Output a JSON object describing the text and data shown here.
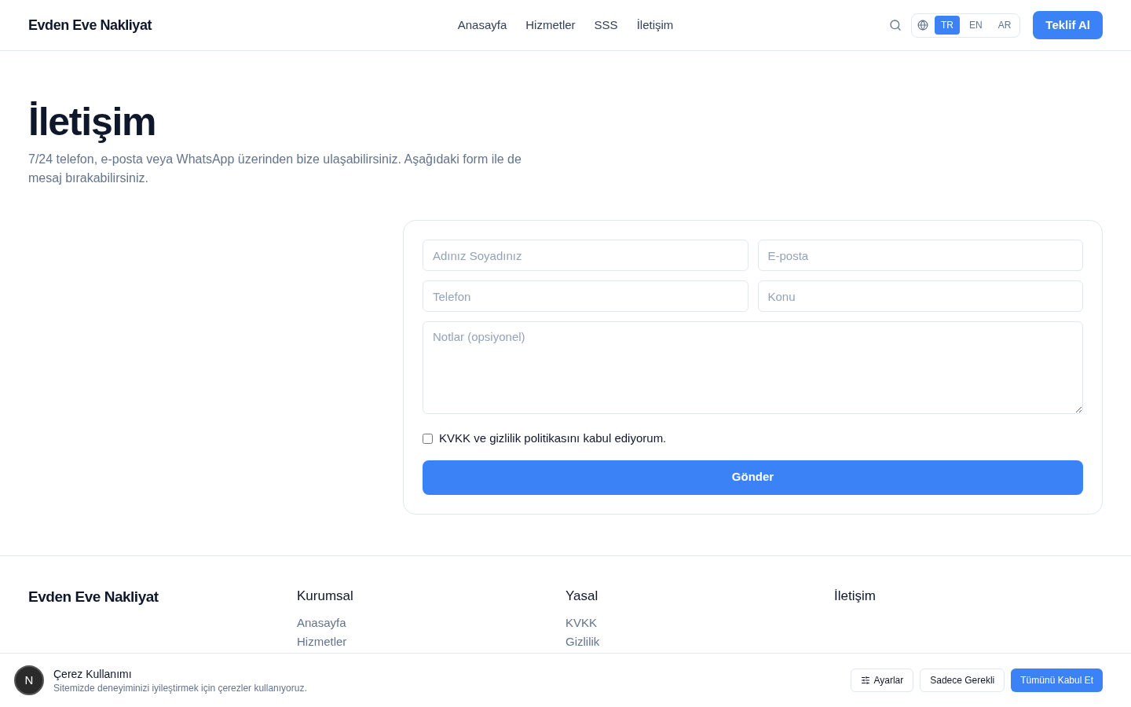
{
  "header": {
    "brand": "Evden Eve Nakliyat",
    "nav": [
      {
        "label": "Anasayfa"
      },
      {
        "label": "Hizmetler"
      },
      {
        "label": "SSS"
      },
      {
        "label": "İletişim"
      }
    ],
    "languages": [
      {
        "label": "TR",
        "selected": true
      },
      {
        "label": "EN",
        "selected": false
      },
      {
        "label": "AR",
        "selected": false
      }
    ],
    "cta": "Teklif Al"
  },
  "hero": {
    "title": "İletişim",
    "subtitle": "7/24 telefon, e-posta veya WhatsApp üzerinden bize ulaşabilirsiniz. Aşağıdaki form ile de mesaj bırakabilirsiniz."
  },
  "form": {
    "fields": [
      {
        "placeholder": "Adınız Soyadınız"
      },
      {
        "placeholder": "E-posta"
      },
      {
        "placeholder": "Telefon"
      },
      {
        "placeholder": "Konu"
      }
    ],
    "notes": {
      "placeholder": "Notlar (opsiyonel)"
    },
    "consent": {
      "label": "KVKK ve gizlilik politikasını kabul ediyorum.",
      "checked": false
    },
    "submit": "Gönder"
  },
  "footer": {
    "brand": "Evden Eve Nakliyat",
    "columns": [
      {
        "title": "Kurumsal",
        "links": [
          "Anasayfa",
          "Hizmetler"
        ]
      },
      {
        "title": "Yasal",
        "links": [
          "KVKK",
          "Gizlilik"
        ]
      },
      {
        "title": "İletişim"
      }
    ]
  },
  "cookie_banner": {
    "badge": "N",
    "title": "Çerez Kullanımı",
    "text": "Sitemizde deneyiminizi iyileştirmek için çerezler kullanıyoruz.",
    "buttons": [
      {
        "kind": "settings",
        "label": "Ayarlar"
      },
      {
        "kind": "outline",
        "label": "Sadece Gerekli"
      },
      {
        "kind": "primary",
        "label": "Tümünü Kabul Et"
      }
    ]
  }
}
